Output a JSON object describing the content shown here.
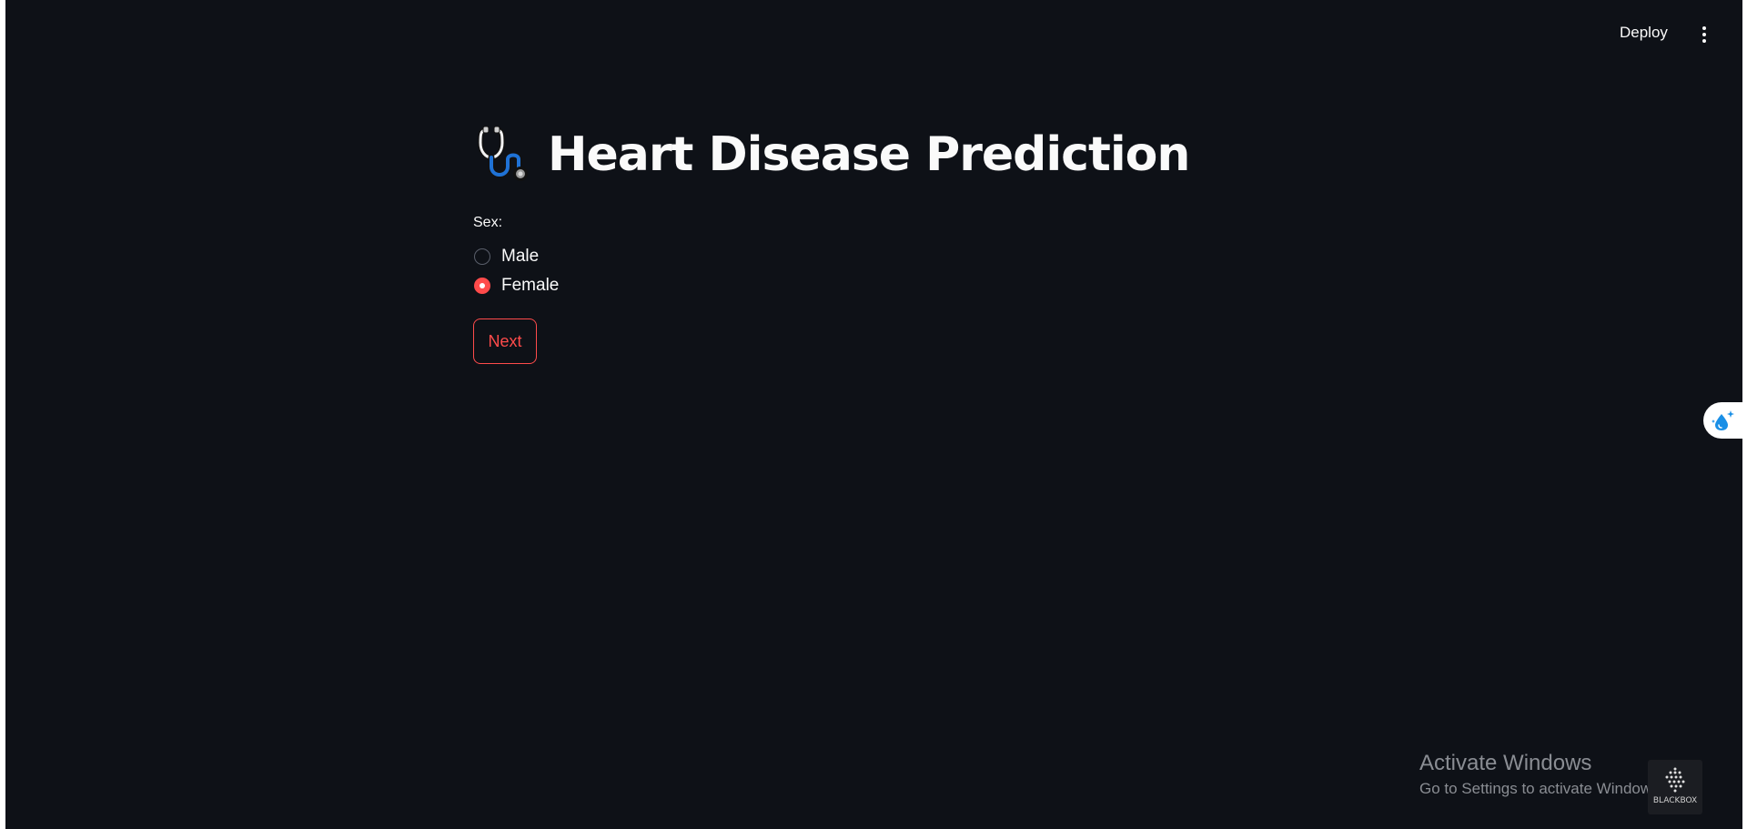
{
  "header": {
    "deploy_label": "Deploy",
    "menu_icon": "kebab-menu-icon"
  },
  "main": {
    "title_icon": "stethoscope-icon",
    "title": "Heart Disease Prediction",
    "sex_label": "Sex:",
    "options": [
      {
        "label": "Male",
        "selected": false
      },
      {
        "label": "Female",
        "selected": true
      }
    ],
    "next_label": "Next"
  },
  "side_widget": {
    "icon": "water-drop-sparkle-icon"
  },
  "watermark": {
    "line1": "Activate Windows",
    "line2": "Go to Settings to activate Windows."
  },
  "brand": {
    "text": "BLACKBOX"
  },
  "colors": {
    "background": "#0e1117",
    "accent": "#ff4b4b",
    "text": "#fafafa"
  }
}
